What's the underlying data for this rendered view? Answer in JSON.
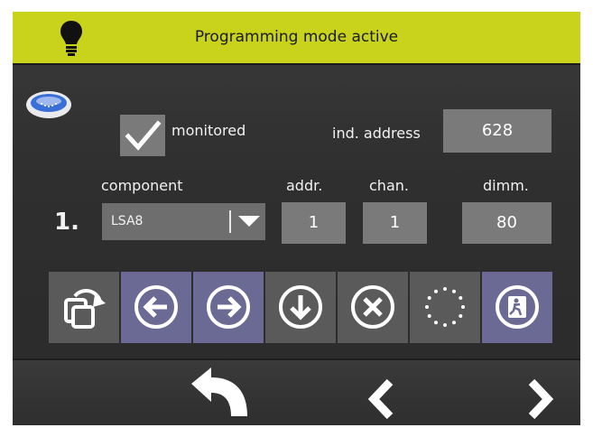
{
  "header": {
    "title": "Programming mode active",
    "icon": "lightbulb-icon",
    "color": "#c9d31c"
  },
  "device": {
    "icon": "luminaire-icon"
  },
  "monitored": {
    "label": "monitored",
    "checked": true
  },
  "ind_address": {
    "label": "ind. address",
    "value": "628"
  },
  "row": {
    "number": "1.",
    "component_label": "component",
    "component_value": "LSA8",
    "addr_label": "addr.",
    "addr_value": "1",
    "chan_label": "chan.",
    "chan_value": "1",
    "dimm_label": "dimm.",
    "dimm_value": "80"
  },
  "toolbar": {
    "buttons": [
      "copy-rotate-icon",
      "arrow-left-circle-icon",
      "arrow-right-circle-icon",
      "arrow-down-circle-icon",
      "close-circle-icon",
      "dotted-circle-icon",
      "emergency-exit-icon"
    ]
  },
  "footer": {
    "buttons": [
      "back-icon",
      "previous-icon",
      "next-icon"
    ]
  }
}
